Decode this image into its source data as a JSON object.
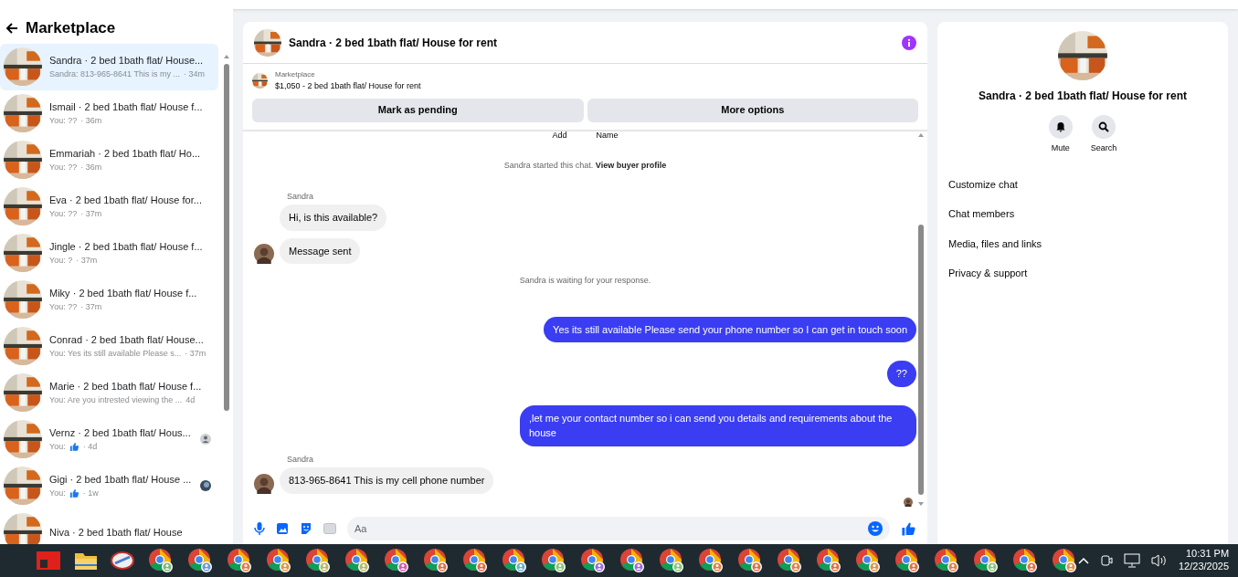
{
  "sidebar": {
    "title": "Marketplace",
    "conversations": [
      {
        "name": "Sandra · 2 bed 1bath flat/ House...",
        "preview": "Sandra: 813-965-8641 This is my ...",
        "time": "· 34m",
        "selected": true,
        "like": false,
        "kind": "plain"
      },
      {
        "name": "Ismail · 2 bed 1bath flat/ House f...",
        "preview": "You: ??",
        "time": "· 36m",
        "selected": false,
        "like": false,
        "kind": "plain"
      },
      {
        "name": "Emmariah · 2 bed 1bath flat/ Ho...",
        "preview": "You: ??",
        "time": "· 36m",
        "selected": false,
        "like": false,
        "kind": "plain"
      },
      {
        "name": "Eva · 2 bed 1bath flat/ House for...",
        "preview": "You: ??",
        "time": "· 37m",
        "selected": false,
        "like": false,
        "kind": "plain"
      },
      {
        "name": "Jingle · 2 bed 1bath flat/ House f...",
        "preview": "You: ?",
        "time": "· 37m",
        "selected": false,
        "like": false,
        "kind": "plain"
      },
      {
        "name": "Miky · 2 bed 1bath flat/ House f...",
        "preview": "You: ??",
        "time": "· 37m",
        "selected": false,
        "like": false,
        "kind": "plain"
      },
      {
        "name": "Conrad · 2 bed 1bath flat/ House...",
        "preview": "You: Yes its still available Please s...",
        "time": "· 37m",
        "selected": false,
        "like": false,
        "kind": "plain"
      },
      {
        "name": "Marie · 2 bed 1bath flat/ House f...",
        "preview": "You: Are you intrested viewing the ...",
        "time": "4d",
        "selected": false,
        "like": false,
        "kind": "plain"
      },
      {
        "name": "Vernz · 2 bed 1bath flat/ Hous...",
        "preview": "You:",
        "time": "· 4d",
        "selected": false,
        "like": true,
        "kind": "silhouette"
      },
      {
        "name": "Gigi · 2 bed 1bath flat/ House ...",
        "preview": "You:",
        "time": "· 1w",
        "selected": false,
        "like": true
      },
      {
        "name": "Niva · 2 bed 1bath flat/ House",
        "selected": false,
        "kind": "plain"
      }
    ]
  },
  "chat": {
    "title": "Sandra · 2 bed 1bath flat/ House for rent",
    "listing": {
      "source": "Marketplace",
      "item": "$1,050 - 2 bed 1bath flat/ House for rent"
    },
    "actions": [
      "Mark as pending",
      "More options"
    ],
    "top_buttons": [
      "Add",
      "Name"
    ],
    "messages": [
      {
        "kind": "system",
        "text": "Sandra started this chat.",
        "link": "View buyer profile"
      },
      {
        "kind": "incoming",
        "sender": "Sandra",
        "text": "Hi, is this available?",
        "avatar": false
      },
      {
        "kind": "incoming",
        "text": "Message sent",
        "avatar": true
      },
      {
        "kind": "system",
        "text": "Sandra is waiting for your response."
      },
      {
        "kind": "outgoing",
        "text": "Yes its still available Please send your phone number so I can get in touch soon"
      },
      {
        "kind": "outgoing",
        "text": "??"
      },
      {
        "kind": "outgoing",
        "text": ",let me your contact number so i can send you details and requirements about the house"
      },
      {
        "kind": "incoming",
        "sender": "Sandra",
        "text": "813-965-8641 This is my cell phone number",
        "avatar": true
      }
    ],
    "composer": {
      "placeholder": "Aa"
    }
  },
  "details": {
    "title": "Sandra · 2 bed 1bath flat/ House for rent",
    "buttons": [
      {
        "label": "Mute",
        "kind": "bell"
      },
      {
        "label": "Search",
        "kind": "search"
      }
    ],
    "items": [
      "Customize chat",
      "Chat members",
      "Media, files and links",
      "Privacy & support"
    ]
  },
  "taskbar": {
    "time": "10:31 PM",
    "date": "12/23/2025"
  }
}
